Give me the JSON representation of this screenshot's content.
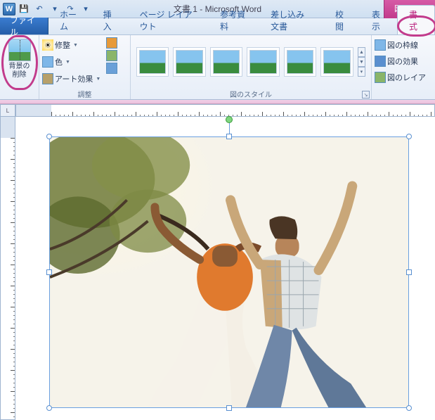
{
  "titlebar": {
    "app_icon_letter": "W",
    "title": "文書 1 - Microsoft Word",
    "context_tab": "図ツール",
    "qat": {
      "save": "💾",
      "undo": "↶",
      "redo": "↷",
      "down": "▾",
      "more": "▾"
    }
  },
  "tabs": {
    "file": "ファイル",
    "items": [
      "ホーム",
      "挿入",
      "ページ レイアウト",
      "参考資料",
      "差し込み文書",
      "校閲",
      "表示",
      "書式"
    ],
    "active": "書式"
  },
  "ribbon": {
    "remove_bg": {
      "label": "背景の\n削除"
    },
    "adjust": {
      "correct": "修整",
      "color": "色",
      "artistic": "アート効果",
      "group_label": "調整"
    },
    "styles": {
      "group_label": "図のスタイル"
    },
    "right": {
      "border": "図の枠線",
      "effects": "図の効果",
      "layout": "図のレイア"
    }
  },
  "ruler": {
    "corner": "L"
  },
  "doc": {
    "selected_image_alt": "selected-picture"
  }
}
